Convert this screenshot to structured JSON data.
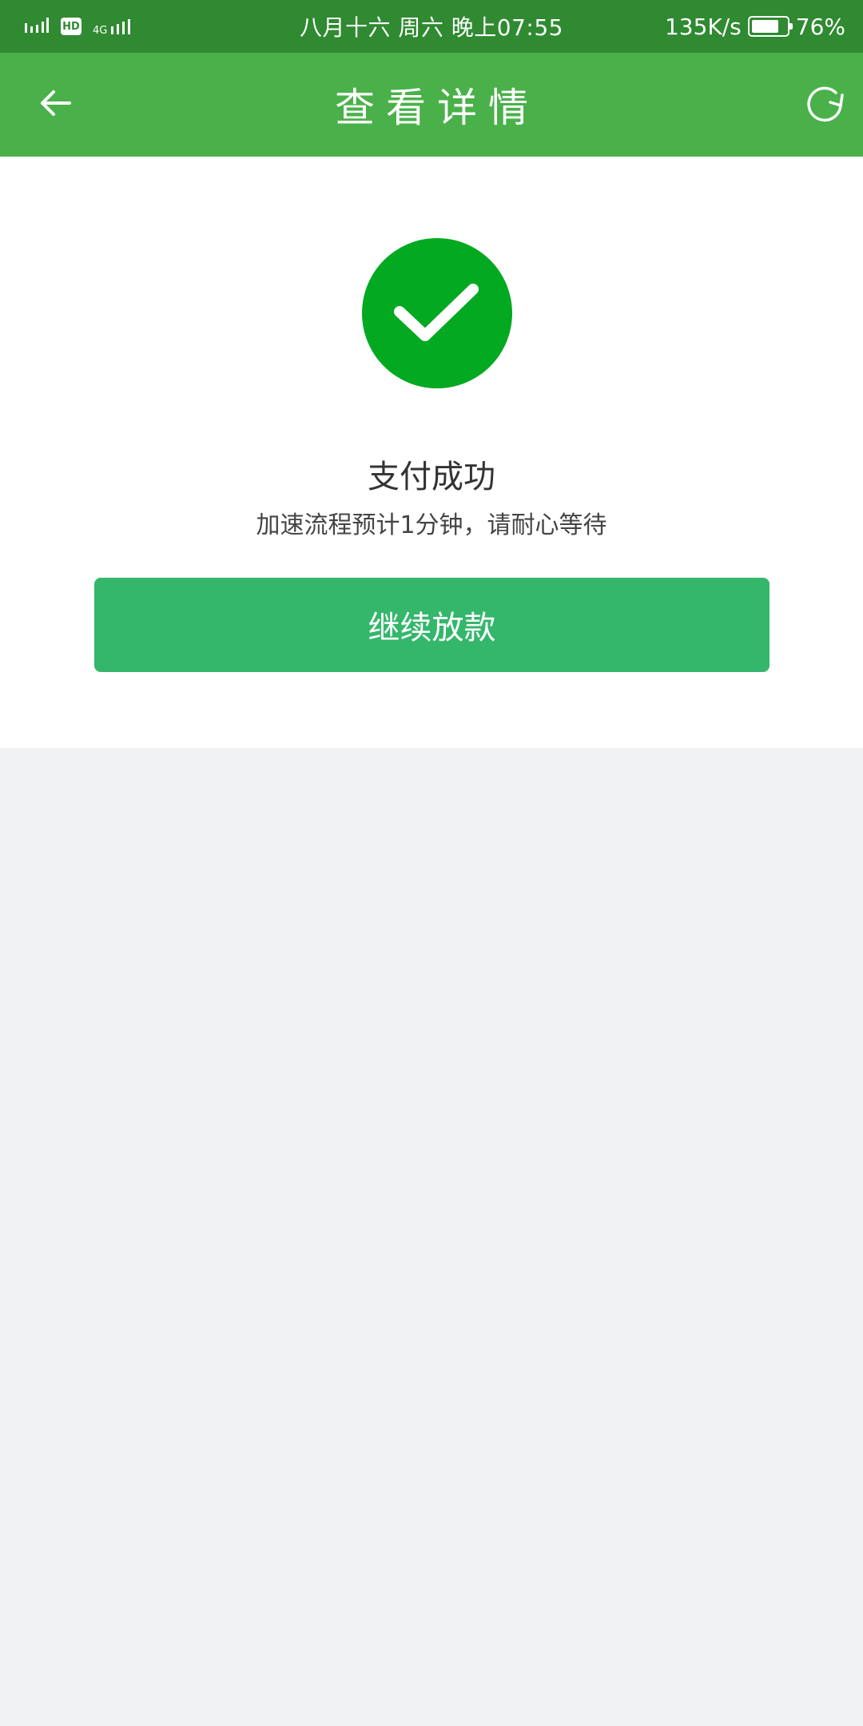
{
  "status_bar": {
    "hd_label": "HD",
    "network_label": "4G",
    "datetime": "八月十六 周六 晚上07:55",
    "net_speed": "135K/s",
    "battery_percent_label": "76%",
    "battery_level": 0.76
  },
  "app_bar": {
    "title": "查看详情",
    "back_icon": "arrow-left-icon",
    "refresh_icon": "refresh-icon"
  },
  "result": {
    "icon": "check-circle-icon",
    "title": "支付成功",
    "subtitle": "加速流程预计1分钟，请耐心等待",
    "button_label": "继续放款"
  },
  "colors": {
    "status_bar": "#2f8a31",
    "app_bar": "#4ab14a",
    "success_icon": "#03a921",
    "button": "#34b76b",
    "page_background": "#f1f2f4"
  }
}
